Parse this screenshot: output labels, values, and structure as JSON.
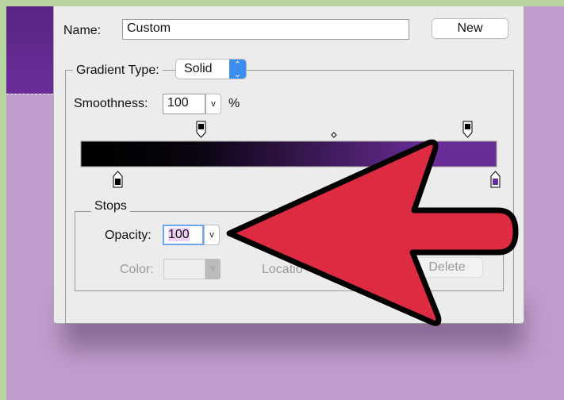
{
  "dialog": {
    "name_label": "Name:",
    "name_value": "Custom",
    "new_button": "New",
    "gradient_type_label": "Gradient Type:",
    "gradient_type_value": "Solid",
    "smoothness_label": "Smoothness:",
    "smoothness_value": "100",
    "smoothness_unit": "%",
    "gradient_colors": [
      "#000000",
      "#6a2d98"
    ],
    "stops": {
      "title": "Stops",
      "opacity_label": "Opacity:",
      "opacity_value": "100",
      "color_label": "Color:",
      "location_label": "Locatio",
      "delete_button": "Delete"
    }
  },
  "colors": {
    "arrow": "#dd2c42",
    "accent": "#3b8ef0"
  }
}
